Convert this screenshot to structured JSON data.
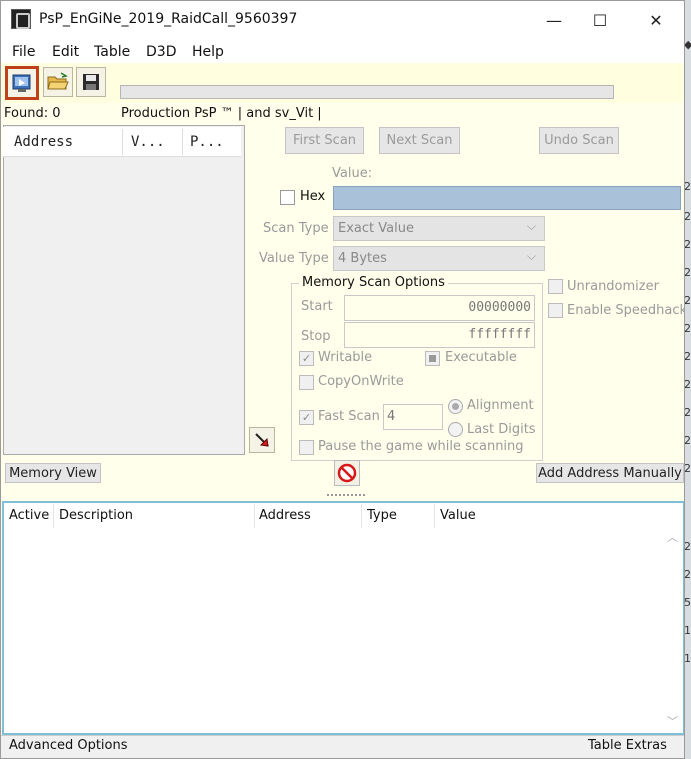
{
  "window": {
    "title": "PsP_EnGiNe_2019_RaidCall_9560397",
    "min": "—",
    "max": "☐",
    "close": "✕"
  },
  "menu": [
    "File",
    "Edit",
    "Table",
    "D3D",
    "Help"
  ],
  "status": {
    "found": "Found: 0",
    "process": "Production PsP ™ | and sv_Vit |"
  },
  "found_list": {
    "columns": [
      "Address",
      "V...",
      "P..."
    ]
  },
  "scan": {
    "first": "First Scan",
    "next": "Next Scan",
    "undo": "Undo Scan",
    "value_label": "Value:",
    "hex_label": "Hex",
    "value": "",
    "scan_type_label": "Scan Type",
    "scan_type": "Exact Value",
    "value_type_label": "Value Type",
    "value_type": "4 Bytes"
  },
  "options": {
    "title": "Memory Scan Options",
    "start_label": "Start",
    "start": "00000000",
    "stop_label": "Stop",
    "stop": "ffffffff",
    "writable": "Writable",
    "executable": "Executable",
    "copyonwrite": "CopyOnWrite",
    "fastscan": "Fast Scan",
    "fastscan_value": "4",
    "alignment": "Alignment",
    "lastdigits": "Last Digits",
    "pause": "Pause the game while scanning",
    "unrandomizer": "Unrandomizer",
    "speedhack": "Enable Speedhack"
  },
  "buttons": {
    "memory_view": "Memory View",
    "add_address": "Add Address Manually"
  },
  "address_table": {
    "columns": [
      "Active",
      "Description",
      "Address",
      "Type",
      "Value"
    ]
  },
  "footer": {
    "left": "Advanced Options",
    "right": "Table Extras"
  },
  "background_strip": [
    "2",
    "2",
    "2",
    "2",
    "2",
    "2",
    "2",
    "2",
    "2",
    "2",
    "2",
    "2",
    "2",
    "5",
    "1",
    "1"
  ],
  "icons": [
    "app-icon",
    "open-process-icon",
    "open-folder-icon",
    "save-icon",
    "pointer-arrow-icon",
    "stop-icon",
    "scroll-up-icon",
    "scroll-down-icon"
  ],
  "colors": {
    "panel": "#ffffec",
    "value_input": "#a9c1d9",
    "highlight": "#c0401a",
    "table_border": "#7fc0d8"
  }
}
